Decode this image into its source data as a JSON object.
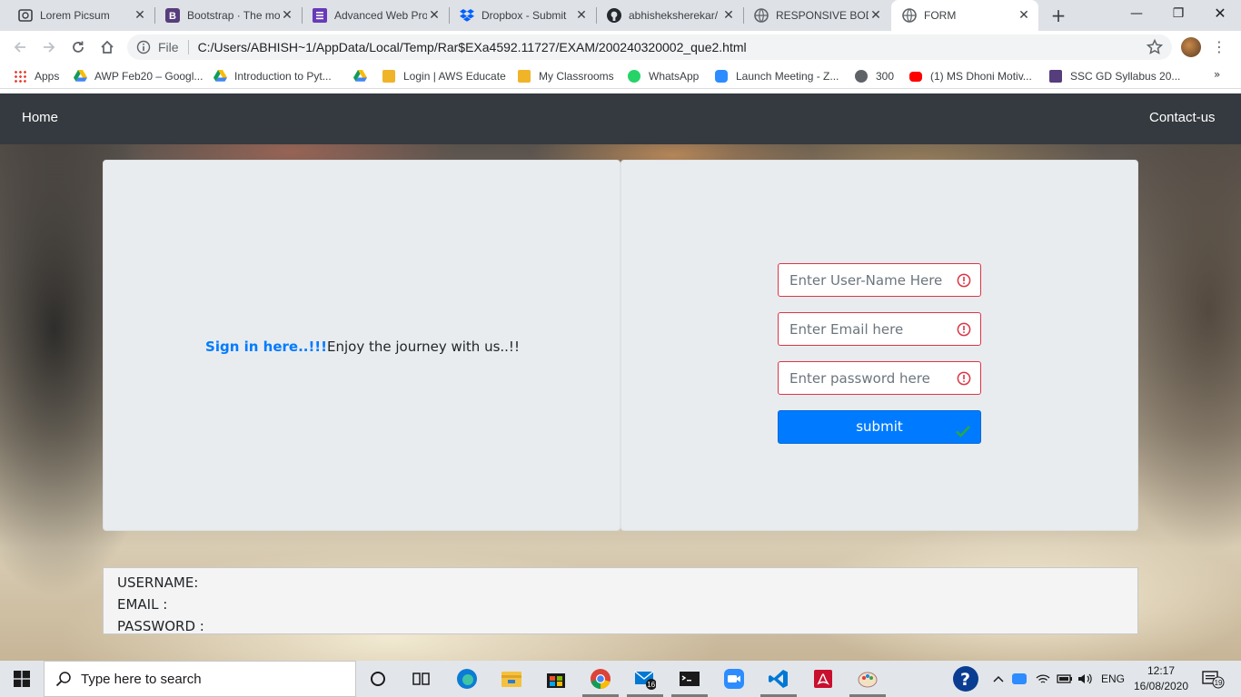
{
  "browser": {
    "tabs": [
      {
        "title": "Lorem Picsum",
        "icon": "picsum-icon"
      },
      {
        "title": "Bootstrap · The mo",
        "icon": "bootstrap-icon"
      },
      {
        "title": "Advanced Web Pro",
        "icon": "forms-icon"
      },
      {
        "title": "Dropbox - Submit",
        "icon": "dropbox-icon"
      },
      {
        "title": "abhisheksherekar/",
        "icon": "github-icon"
      },
      {
        "title": "RESPONSIVE BOD",
        "icon": "globe-icon"
      },
      {
        "title": "FORM",
        "icon": "globe-icon",
        "active": true
      }
    ],
    "address": {
      "scheme": "File",
      "url": "C:/Users/ABHISH~1/AppData/Local/Temp/Rar$EXa4592.11727/EXAM/200240320002_que2.html"
    },
    "bookmarks": [
      {
        "label": "Apps",
        "icon": "apps-grid-icon"
      },
      {
        "label": "AWP Feb20 – Googl...",
        "icon": "drive-icon"
      },
      {
        "label": "Introduction to Pyt...",
        "icon": "drive-icon"
      },
      {
        "label": "",
        "icon": "drive-icon"
      },
      {
        "label": "Login | AWS Educate",
        "icon": "box-icon"
      },
      {
        "label": "My Classrooms",
        "icon": "box-icon"
      },
      {
        "label": "WhatsApp",
        "icon": "whatsapp-icon"
      },
      {
        "label": "Launch Meeting - Z...",
        "icon": "zoom-icon"
      },
      {
        "label": "300",
        "icon": "globe-icon"
      },
      {
        "label": "(1) MS Dhoni Motiv...",
        "icon": "youtube-icon"
      },
      {
        "label": "SSC GD Syllabus 20...",
        "icon": "bootstrap-icon"
      }
    ],
    "bookmarks_more": "»"
  },
  "page": {
    "nav": {
      "home": "Home",
      "contact": "Contact-us"
    },
    "tagline": {
      "highlight": "Sign in here..!!!",
      "rest": "Enjoy the journey with us..!!"
    },
    "form": {
      "username_placeholder": "Enter User-Name Here",
      "email_placeholder": "Enter Email here",
      "password_placeholder": "Enter password here",
      "submit_label": "submit"
    },
    "output": {
      "username_label": "USERNAME:",
      "email_label": "EMAIL :",
      "password_label": "PASSWORD :"
    },
    "colors": {
      "navbar": "#343a40",
      "primary": "#007bff",
      "danger": "#dc3545",
      "card": "#e9ecef"
    }
  },
  "taskbar": {
    "search_placeholder": "Type here to search",
    "mail_badge": "16",
    "language": "ENG",
    "time": "12:17",
    "date": "16/08/2020",
    "notification_count": "19"
  }
}
